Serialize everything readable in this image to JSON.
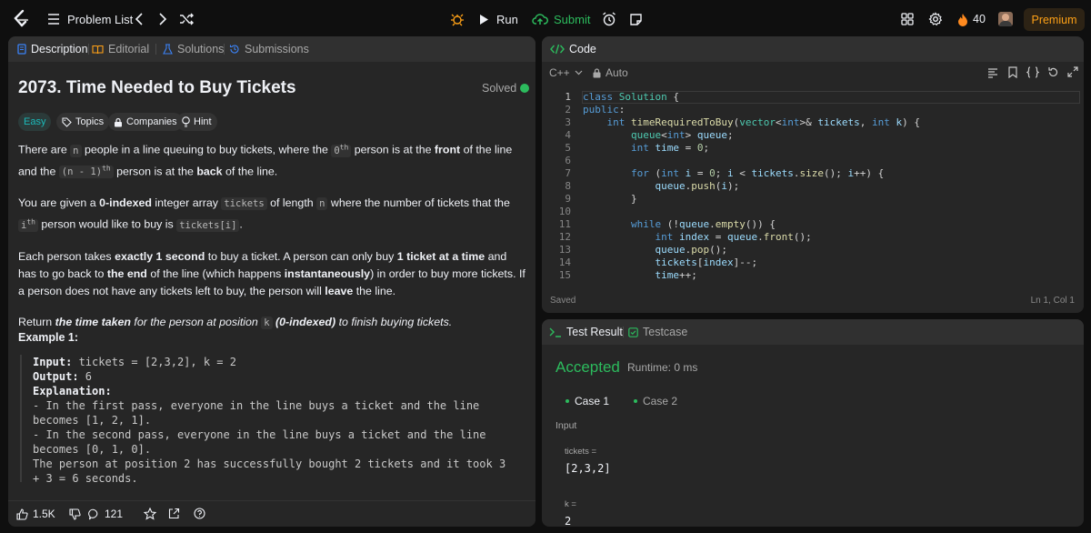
{
  "topbar": {
    "problem_list": "Problem List",
    "run": "Run",
    "submit": "Submit",
    "streak": "40",
    "premium": "Premium"
  },
  "left": {
    "tabs": [
      "Description",
      "Editorial",
      "Solutions",
      "Submissions"
    ],
    "title": "2073. Time Needed to Buy Tickets",
    "solved": "Solved",
    "difficulty": "Easy",
    "tags": [
      "Topics",
      "Companies",
      "Hint"
    ],
    "para1": {
      "a": "There are ",
      "n": "n",
      "b": " people in a line queuing to buy tickets, where the ",
      "zero_sup": "th",
      "zero": "0",
      "c": " person is at the ",
      "front": "front",
      "d": " of the line and the ",
      "n1": "(n - 1)",
      "n1_sup": "th",
      "e": " person is at the ",
      "back": "back",
      "f": " of the line."
    },
    "para2": {
      "a": "You are given a ",
      "indexed": "0-indexed",
      "b": " integer array ",
      "tickets": "tickets",
      "c": " of length ",
      "n": "n",
      "d": " where the number of tickets that the ",
      "i": "i",
      "i_sup": "th",
      "e": " person would like to buy is ",
      "ti": "tickets[i]",
      "f": "."
    },
    "para3": {
      "a": "Each person takes ",
      "sec": "exactly 1 second",
      "b": " to buy a ticket. A person can only buy ",
      "one": "1 ticket at a time",
      "c": " and has to go back to ",
      "end": "the end",
      "d": " of the line (which happens ",
      "inst": "instantaneously",
      "e": ") in order to buy more tickets. If a person does not have any tickets left to buy, the person will ",
      "leave": "leave",
      "f": " the line."
    },
    "para4": {
      "a": "Return ",
      "the": "the ",
      "tt": "time taken",
      "b": " for the person at position ",
      "k": "k",
      "c": " ",
      "idx": "(0-indexed)",
      "d": " to finish buying tickets."
    },
    "example_title": "Example 1:",
    "example": {
      "input_label": "Input:",
      "input_val": " tickets = [2,3,2], k = 2",
      "output_label": "Output:",
      "output_val": " 6",
      "expl_label": "Explanation:",
      "line1": "- In the first pass, everyone in the line buys a ticket and the line becomes [1, 2, 1].",
      "line2": "- In the second pass, everyone in the line buys a ticket and the line becomes [0, 1, 0].",
      "line3": "The person at position 2 has successfully bought 2 tickets and it took 3 + 3 = 6 seconds."
    },
    "likes": "1.5K",
    "comments": "121"
  },
  "code": {
    "tab": "Code",
    "language": "C++",
    "auto": "Auto",
    "saved": "Saved",
    "cursor": "Ln 1, Col 1",
    "line_numbers": [
      "1",
      "2",
      "3",
      "4",
      "5",
      "6",
      "7",
      "8",
      "9",
      "10",
      "11",
      "12",
      "13",
      "14",
      "15"
    ]
  },
  "test": {
    "tabs": [
      "Test Result",
      "Testcase"
    ],
    "status": "Accepted",
    "runtime": "Runtime: 0 ms",
    "cases": [
      "Case 1",
      "Case 2"
    ],
    "input_label": "Input",
    "params": [
      {
        "name": "tickets =",
        "value": "[2,3,2]"
      },
      {
        "name": "k =",
        "value": "2"
      }
    ]
  },
  "colors": {
    "accent_green": "#2cbb5d",
    "easy": "#1cbaba",
    "premium": "#ffa116",
    "streak": "#ff8a1f"
  }
}
